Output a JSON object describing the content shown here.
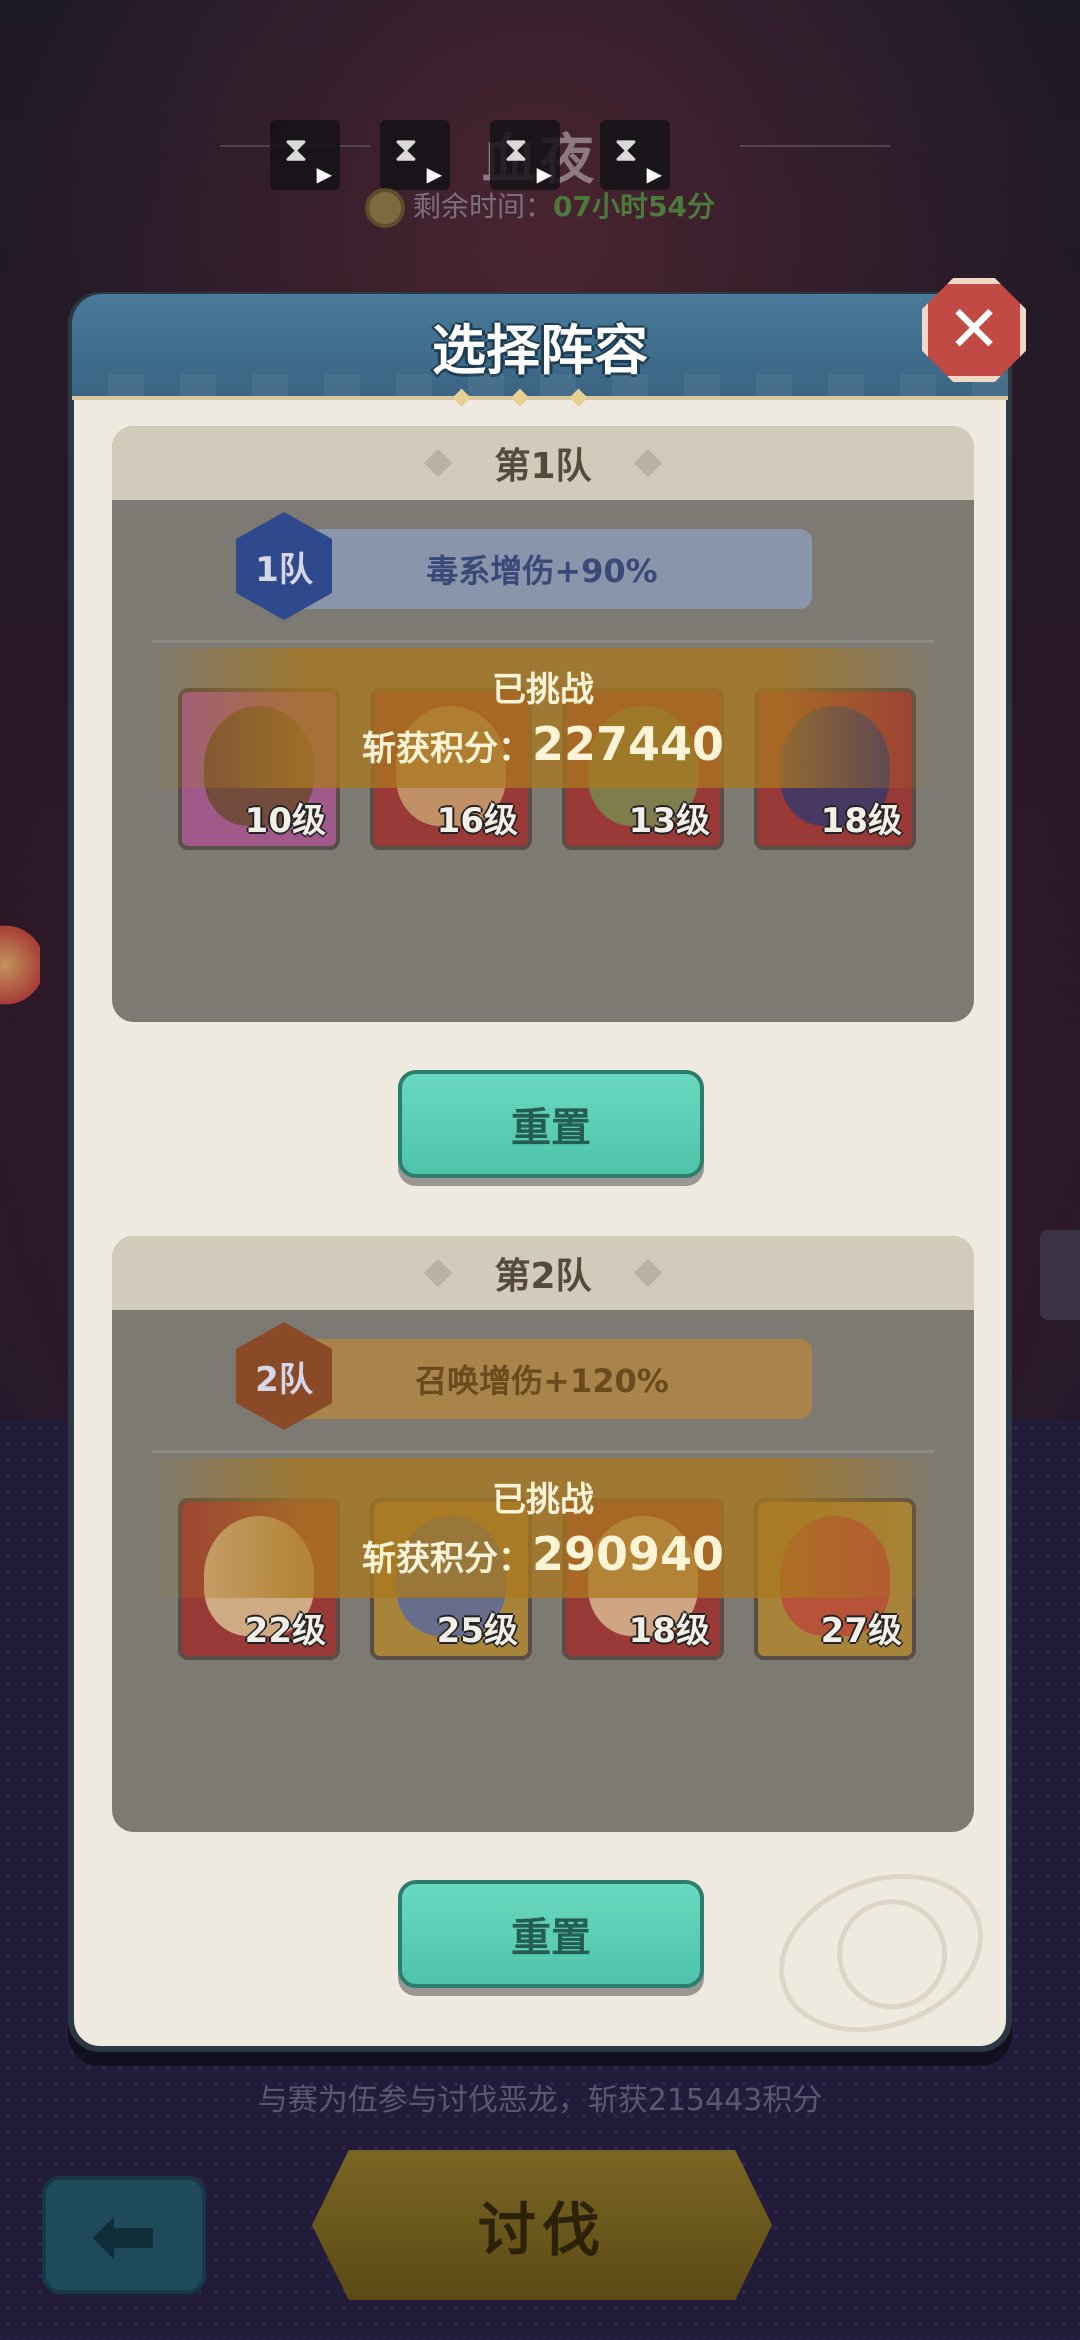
{
  "background": {
    "event_title": "血夜",
    "timer_label": "剩余时间：",
    "timer_value": "07小时54分",
    "bottom_note": "与赛为伍参与讨伐恶龙，斩获215443积分",
    "attack_button": "讨伐",
    "back_icon": "arrow-left-icon",
    "play_buttons": [
      "▶",
      "▶",
      "▶",
      "▶"
    ]
  },
  "modal": {
    "title": "选择阵容",
    "close_icon": "close-icon",
    "teams": [
      {
        "title": "第1队",
        "badge": "1队",
        "bonus": "毒系增伤+90%",
        "status": "已挑战",
        "score_label": "斩获积分：",
        "score": "227440",
        "heroes": [
          "10级",
          "16级",
          "13级",
          "18级"
        ],
        "reset_label": "重置"
      },
      {
        "title": "第2队",
        "badge": "2队",
        "bonus": "召唤增伤+120%",
        "status": "已挑战",
        "score_label": "斩获积分：",
        "score": "290940",
        "heroes": [
          "22级",
          "25级",
          "18级",
          "27级"
        ],
        "reset_label": "重置"
      }
    ]
  },
  "colors": {
    "team1_badge": "#2f4a8c",
    "team1_bar": "#8a94aa",
    "team2_badge": "#8a4a28",
    "team2_bar": "#a8834a",
    "reset_button": "#5ccfb6",
    "modal_header": "#3f6e8e",
    "close_button": "#c24a44"
  }
}
